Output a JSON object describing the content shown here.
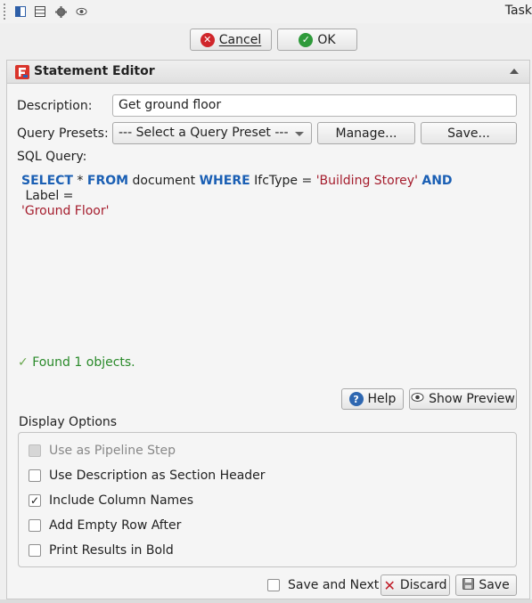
{
  "topbar": {
    "task_label": "Task",
    "icons": [
      "panel-icon",
      "layout-icon",
      "gear-icon",
      "eye-icon"
    ]
  },
  "dialog": {
    "cancel_label": "Cancel",
    "ok_label": "OK"
  },
  "panel": {
    "title": "Statement Editor",
    "description_label": "Description:",
    "description_value": "Get ground floor",
    "presets_label": "Query Presets:",
    "presets_selected": "--- Select a Query Preset ---",
    "manage_label": "Manage...",
    "save_preset_label": "Save...",
    "sql_label": "SQL Query:",
    "sql": {
      "kw_select": "SELECT",
      "t1": " * ",
      "kw_from": "FROM",
      "t2": " document ",
      "kw_where": "WHERE",
      "t3": " IfcType = ",
      "s1": "'Building Storey'",
      "t4": " ",
      "kw_and": "AND",
      "t5": " Label =",
      "s2": "'Ground Floor'"
    },
    "status": "Found 1 objects.",
    "help_label": "Help",
    "preview_label": "Show Preview",
    "display_options_label": "Display Options",
    "options": [
      {
        "label": "Use as Pipeline Step",
        "checked": false,
        "disabled": true
      },
      {
        "label": "Use Description as Section Header",
        "checked": false,
        "disabled": false
      },
      {
        "label": "Include Column Names",
        "checked": true,
        "disabled": false
      },
      {
        "label": "Add Empty Row After",
        "checked": false,
        "disabled": false
      },
      {
        "label": "Print Results in Bold",
        "checked": false,
        "disabled": false
      }
    ],
    "save_next_label": "Save and Next",
    "discard_label": "Discard",
    "save_label": "Save"
  },
  "colors": {
    "keyword": "#1a5fb4",
    "string": "#a51d2d",
    "status": "#2a8a2a",
    "cancel_icon": "#d0262b",
    "ok_icon": "#2e9a3a",
    "help_icon": "#2e67b1",
    "discard_icon": "#c01c28"
  }
}
